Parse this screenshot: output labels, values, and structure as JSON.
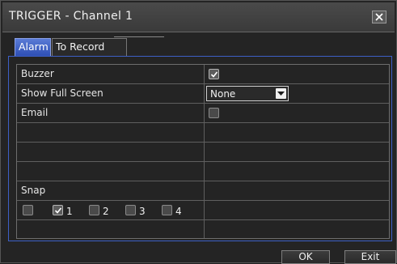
{
  "dialog": {
    "title": "TRIGGER - Channel 1",
    "close_icon": "close-x-icon"
  },
  "tabs": [
    {
      "label": "Alarm",
      "active": true
    },
    {
      "label": "To Record",
      "active": false
    }
  ],
  "settings": {
    "buzzer": {
      "label": "Buzzer",
      "checked": true
    },
    "show_full_screen": {
      "label": "Show Full Screen",
      "value": "None"
    },
    "email": {
      "label": "Email",
      "checked": false
    },
    "snap": {
      "label": "Snap"
    }
  },
  "snap_channels": [
    {
      "label": "",
      "checked": false
    },
    {
      "label": "1",
      "checked": true
    },
    {
      "label": "2",
      "checked": false
    },
    {
      "label": "3",
      "checked": false
    },
    {
      "label": "4",
      "checked": false
    }
  ],
  "footer": {
    "ok_label": "OK",
    "exit_label": "Exit"
  },
  "colors": {
    "tab_active": "#2e4fb4",
    "panel_border": "#3d5fc6"
  }
}
